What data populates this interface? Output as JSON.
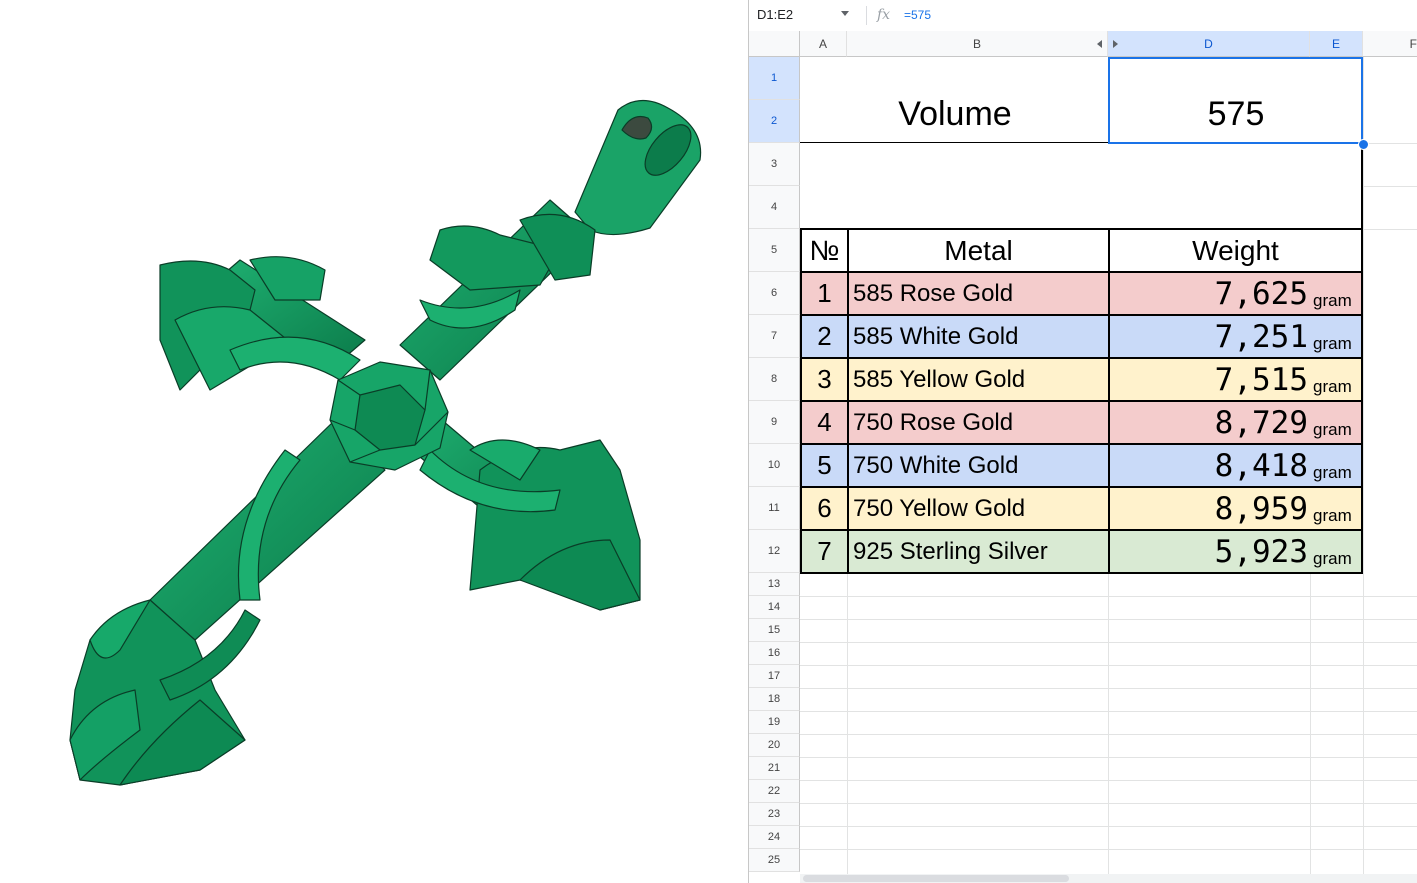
{
  "formula_bar": {
    "name_box": "D1:E2",
    "fx_symbol": "fx",
    "formula": "=575"
  },
  "columns": [
    "A",
    "B",
    "D",
    "E",
    "F"
  ],
  "rows": [
    "1",
    "2",
    "3",
    "4",
    "5",
    "6",
    "7",
    "8",
    "9",
    "10",
    "11",
    "12",
    "13",
    "14",
    "15",
    "16",
    "17",
    "18",
    "19",
    "20",
    "21",
    "22",
    "23",
    "24",
    "25"
  ],
  "volume": {
    "label": "Volume",
    "value": "575"
  },
  "table": {
    "headers": {
      "number": "№",
      "metal": "Metal",
      "weight": "Weight"
    },
    "unit": "gram",
    "rows": [
      {
        "n": "1",
        "metal": "585 Rose Gold",
        "weight": "7,625",
        "color": "#f4cccc"
      },
      {
        "n": "2",
        "metal": "585 White Gold",
        "weight": "7,251",
        "color": "#c9daf8"
      },
      {
        "n": "3",
        "metal": "585 Yellow Gold",
        "weight": "7,515",
        "color": "#fff2cc"
      },
      {
        "n": "4",
        "metal": "750 Rose Gold",
        "weight": "8,729",
        "color": "#f4cccc"
      },
      {
        "n": "5",
        "metal": "750 White Gold",
        "weight": "8,418",
        "color": "#c9daf8"
      },
      {
        "n": "6",
        "metal": "750 Yellow Gold",
        "weight": "8,959",
        "color": "#fff2cc"
      },
      {
        "n": "7",
        "metal": "925 Sterling Silver",
        "weight": "5,923",
        "color": "#d9ead3"
      }
    ]
  },
  "colors": {
    "model_green": "#0f9a5e",
    "model_edge": "#0a3d27",
    "selection": "#1a73e8"
  },
  "icons": {
    "name_box_dropdown": "chevron-down-icon",
    "formula": "fx-icon"
  }
}
